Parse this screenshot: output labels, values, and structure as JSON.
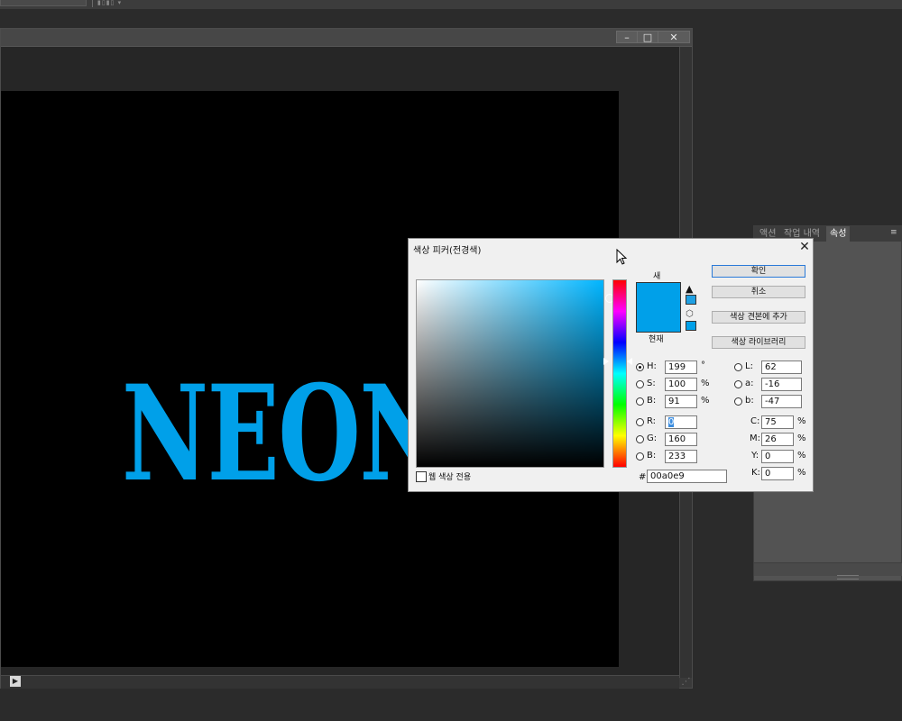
{
  "canvas": {
    "text": "NEON",
    "text_color": "#00a0e9",
    "background_color": "#000000"
  },
  "window_controls": {
    "minimize": "–",
    "maximize": "□",
    "close": "✕"
  },
  "panel": {
    "tabs": [
      "액션",
      "작업 내역",
      "속성"
    ],
    "active_tab": "속성"
  },
  "picker": {
    "title": "색상 피커(전경색)",
    "close": "✕",
    "new_label": "새",
    "current_label": "현재",
    "swatch_color": "#00a0e9",
    "buttons": {
      "ok": "확인",
      "cancel": "취소",
      "add_to_swatches": "색상 견본에 추가",
      "libraries": "색상 라이브러리"
    },
    "web_only": "웹 색상 전용",
    "hsb": [
      {
        "label": "H:",
        "value": "199",
        "unit": "°",
        "checked": true
      },
      {
        "label": "S:",
        "value": "100",
        "unit": "%",
        "checked": false
      },
      {
        "label": "B:",
        "value": "91",
        "unit": "%",
        "checked": false
      }
    ],
    "rgb": [
      {
        "label": "R:",
        "value": "0"
      },
      {
        "label": "G:",
        "value": "160"
      },
      {
        "label": "B:",
        "value": "233"
      }
    ],
    "lab": [
      {
        "label": "L:",
        "value": "62"
      },
      {
        "label": "a:",
        "value": "-16"
      },
      {
        "label": "b:",
        "value": "-47"
      }
    ],
    "cmyk": [
      {
        "label": "C:",
        "value": "75",
        "unit": "%"
      },
      {
        "label": "M:",
        "value": "26",
        "unit": "%"
      },
      {
        "label": "Y:",
        "value": "0",
        "unit": "%"
      },
      {
        "label": "K:",
        "value": "0",
        "unit": "%"
      }
    ],
    "hex_label": "#",
    "hex_value": "00a0e9"
  }
}
